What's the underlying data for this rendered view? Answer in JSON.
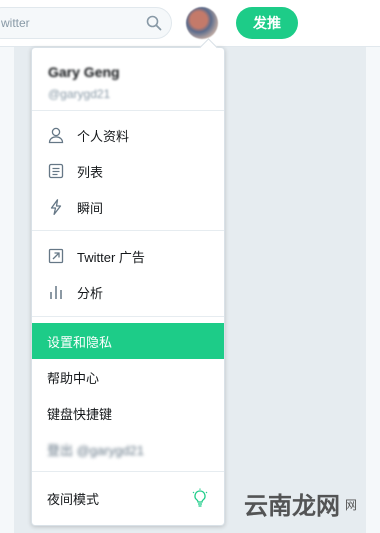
{
  "search": {
    "text": "witter"
  },
  "header": {
    "tweet_button_label": "发推"
  },
  "menu": {
    "user_name": "Gary Geng",
    "user_handle": "@garygd21",
    "group1": [
      {
        "label": "个人资料",
        "icon": "person-icon"
      },
      {
        "label": "列表",
        "icon": "list-icon"
      },
      {
        "label": "瞬间",
        "icon": "lightning-icon"
      }
    ],
    "group2": [
      {
        "label": "Twitter 广告",
        "icon": "external-link-icon"
      },
      {
        "label": "分析",
        "icon": "analytics-icon"
      }
    ],
    "group3": [
      {
        "label": "设置和隐私"
      },
      {
        "label": "帮助中心"
      },
      {
        "label": "键盘快捷键"
      },
      {
        "label": "登出 @garygd21"
      }
    ],
    "night_mode_label": "夜间模式"
  },
  "watermark": {
    "text": "云南龙网",
    "suffix": "网"
  },
  "colors": {
    "accent": "#1dcc88",
    "border": "#e1e8ed",
    "text": "#14171a",
    "muted": "#657786"
  }
}
